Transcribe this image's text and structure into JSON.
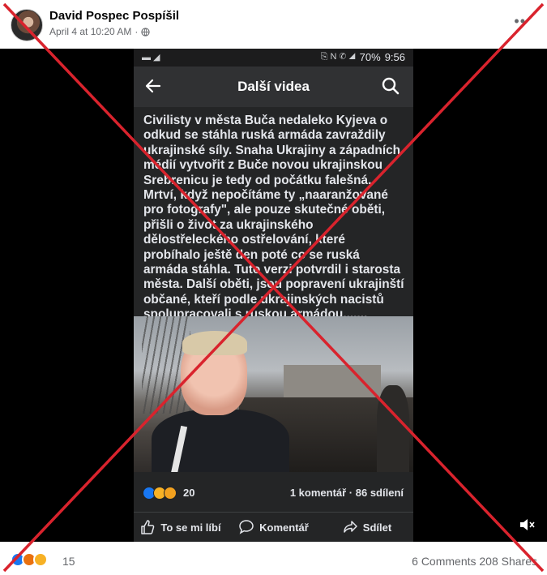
{
  "post": {
    "author": "David Pospec Pospíšil",
    "timestamp": "April 4 at 10:20 AM",
    "privacy_icon": "globe-icon",
    "more_icon": "more-dots-icon"
  },
  "phone": {
    "status_bar": {
      "left_icons": "▬ ◢",
      "right_icons": "⎘ N ✆ ◢",
      "battery": "70%",
      "time": "9:56"
    },
    "top_bar": {
      "title": "Další videa",
      "back_icon": "arrow-left-icon",
      "search_icon": "search-icon"
    },
    "caption": "Civilisty v města Buča nedaleko Kyjeva o odkud se stáhla ruská armáda zavraždily ukrajinské síly. Snaha Ukrajiny a západních médií vytvořit z Buče novou ukrajinskou Srebrenicu je tedy od počátku falešná. Mrtví, když nepočítáme ty „naaranžované pro fotografy\", ale pouze skutečné oběti, přišli o život za ukrajinského dělostřeleckého ostřelování, které probíhalo ještě den poté co se ruská armáda stáhla. Tuto verzi potvrdil i starosta města. Další oběti, jsou popravení ukrajinští občané, kteří podle ukrajinských nacistů spolupracovali s ruskou armádou.......",
    "reactions": {
      "count": "20",
      "stats": "1 komentář · 86 sdílení"
    },
    "actions": {
      "like": "To se mi líbí",
      "comment": "Komentář",
      "share": "Sdílet"
    }
  },
  "footer": {
    "reaction_count": "15",
    "comments": "6 Comments",
    "shares": "208 Shares"
  },
  "colors": {
    "cross": "#d9232d",
    "like": "#1877f2",
    "angry": "#e9710f",
    "sad": "#f7b125"
  }
}
